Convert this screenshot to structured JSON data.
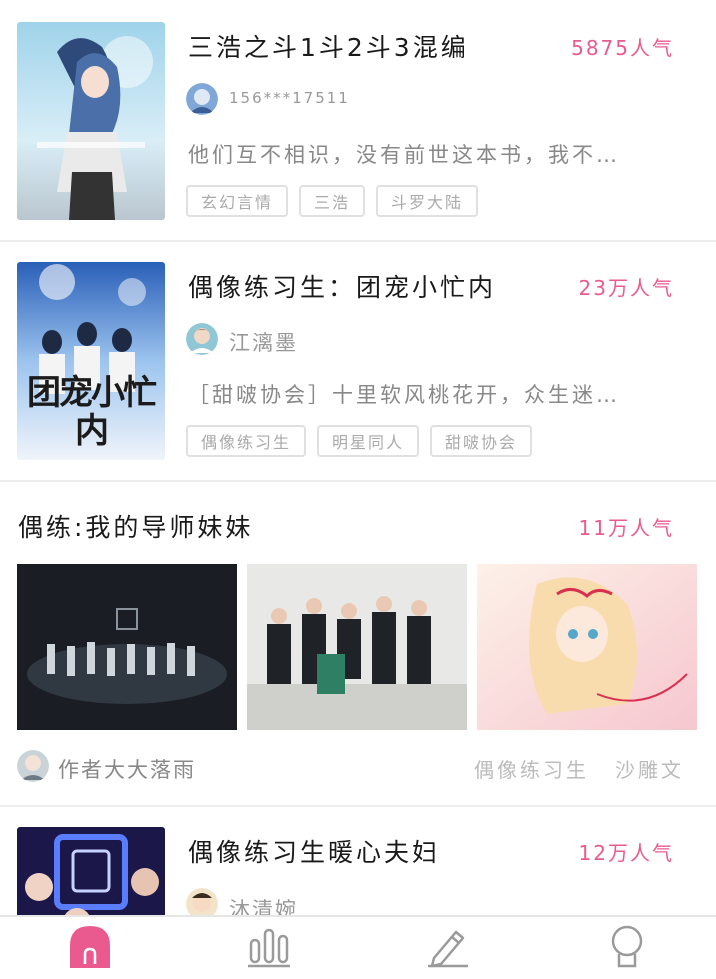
{
  "feed": {
    "items": [
      {
        "title": "三浩之斗1斗2斗3混编",
        "popularity": "5875人气",
        "author": "156***17511",
        "description": "他们互不相识，没有前世这本书，我不…",
        "tags": [
          "玄幻言情",
          "三浩",
          "斗罗大陆"
        ]
      },
      {
        "title": "偶像练习生：团宠小忙内",
        "popularity": "23万人气",
        "author": "江漓墨",
        "description": "［甜啵协会］十里软风桃花开，众生迷…",
        "tags": [
          "偶像练习生",
          "明星同人",
          "甜啵协会"
        ],
        "cover_text": "团宠小忙内"
      },
      {
        "title": "偶练:我的导师妹妹",
        "popularity": "11万人气",
        "author": "作者大大落雨",
        "tags": [
          "偶像练习生",
          "沙雕文"
        ]
      },
      {
        "title": "偶像练习生暖心夫妇",
        "popularity": "12万人气",
        "author": "沐清婉"
      }
    ]
  },
  "tabbar": {
    "tabs": [
      {
        "icon": "home-arch-icon",
        "active": true
      },
      {
        "icon": "ranking-bars-icon",
        "active": false
      },
      {
        "icon": "pencil-icon",
        "active": false
      },
      {
        "icon": "profile-icon",
        "active": false
      }
    ]
  },
  "colors": {
    "accent": "#ea5a8f",
    "muted": "#999999",
    "divider": "#ececec"
  }
}
